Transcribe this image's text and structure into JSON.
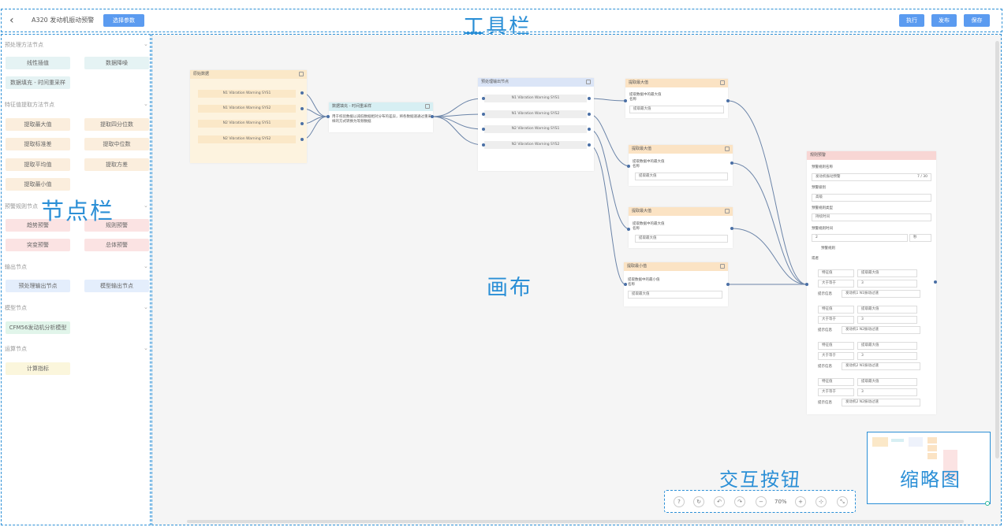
{
  "toolbar": {
    "back": "‹",
    "title": "A320 发动机振动预警",
    "select_params": "选择参数",
    "run": "执行",
    "publish": "发布",
    "save": "保存",
    "caption": "工具栏"
  },
  "sidebar": {
    "caption": "节点栏",
    "groups": [
      {
        "title": "预处理方法节点",
        "items": [
          "线性插值",
          "数据降噪",
          "数据填充 - 时间重采样"
        ]
      },
      {
        "title": "特征值提取方法节点",
        "items": [
          "提取最大值",
          "提取四分位数",
          "提取标准差",
          "提取中位数",
          "提取平均值",
          "提取方差",
          "提取最小值"
        ]
      },
      {
        "title": "预警规则节点",
        "items": [
          "趋势预警",
          "规则预警",
          "突变预警",
          "总体预警"
        ]
      },
      {
        "title": "输出节点",
        "items": [
          "预处理输出节点",
          "模型输出节点"
        ]
      },
      {
        "title": "模型节点",
        "items": [
          "CFM56发动机分析模型"
        ]
      },
      {
        "title": "运算节点",
        "items": [
          "计算指标"
        ]
      }
    ]
  },
  "canvas": {
    "caption": "画布",
    "source": {
      "title": "原始数据",
      "rows": [
        "N1 Vibration Warning SYS1",
        "N1 Vibration Warning SYS2",
        "N2 Vibration Warning SYS1",
        "N2 Vibration Warning SYS2"
      ]
    },
    "resample": {
      "title": "数据填充 - 时间重采样",
      "desc": "用于校验数据以减低数据相对分布的差异，将各数据速通过重采样的方式转换为等频数据"
    },
    "output": {
      "title": "预处理输出节点",
      "rows": [
        "N1 Vibration Warning SYS1",
        "N1 Vibration Warning SYS2",
        "N2 Vibration Warning SYS1",
        "N2 Vibration Warning SYS2"
      ]
    },
    "max_nodes": [
      {
        "title": "提取最大值",
        "desc": "提取数据中的最大值",
        "name_label": "名称",
        "value": "提取最大值"
      },
      {
        "title": "提取最大值",
        "desc": "提取数据中的最大值",
        "name_label": "名称",
        "value": "提取最大值"
      },
      {
        "title": "提取最大值",
        "desc": "提取数据中的最大值",
        "name_label": "名称",
        "value": "提取最大值"
      },
      {
        "title": "提取最小值",
        "desc": "提取数据中的最小值",
        "name_label": "名称",
        "value": "提取最大值"
      }
    ],
    "rule": {
      "title": "规则预警",
      "name_label": "预警规则名称",
      "name_value": "发动机振动预警",
      "count": "7 / 30",
      "level_label": "预警级别",
      "level_value": "高级",
      "type_label": "预警规则类型",
      "type_value": "持续时间",
      "time_label": "预警规则时间",
      "time_value": "2",
      "time_unit": "秒",
      "section": "预警规则",
      "logic": "或者",
      "conds": [
        {
          "a": "特征值",
          "b": "提取最大值",
          "op": "大于等于",
          "v": "3",
          "tip_label": "提示信息",
          "tip": "发动机1 N1振动过速"
        },
        {
          "a": "特征值",
          "b": "提取最大值",
          "op": "大于等于",
          "v": "3",
          "tip_label": "提示信息",
          "tip": "发动机1 N2振动过速"
        },
        {
          "a": "特征值",
          "b": "提取最大值",
          "op": "大于等于",
          "v": "3",
          "tip_label": "提示信息",
          "tip": "发动机2 N1振动过速"
        },
        {
          "a": "特征值",
          "b": "提取最大值",
          "op": "大于等于",
          "v": "3",
          "tip_label": "提示信息",
          "tip": "发动机2 N2振动过速"
        }
      ]
    }
  },
  "controls": {
    "caption": "交互按钮",
    "zoom": "70%",
    "help": "?",
    "refresh": "↻",
    "undo": "↶",
    "redo": "↷",
    "zoom_out": "−",
    "zoom_in": "+",
    "fit": "⊹",
    "collapse": "⤡"
  },
  "minimap": {
    "caption": "缩略图"
  }
}
